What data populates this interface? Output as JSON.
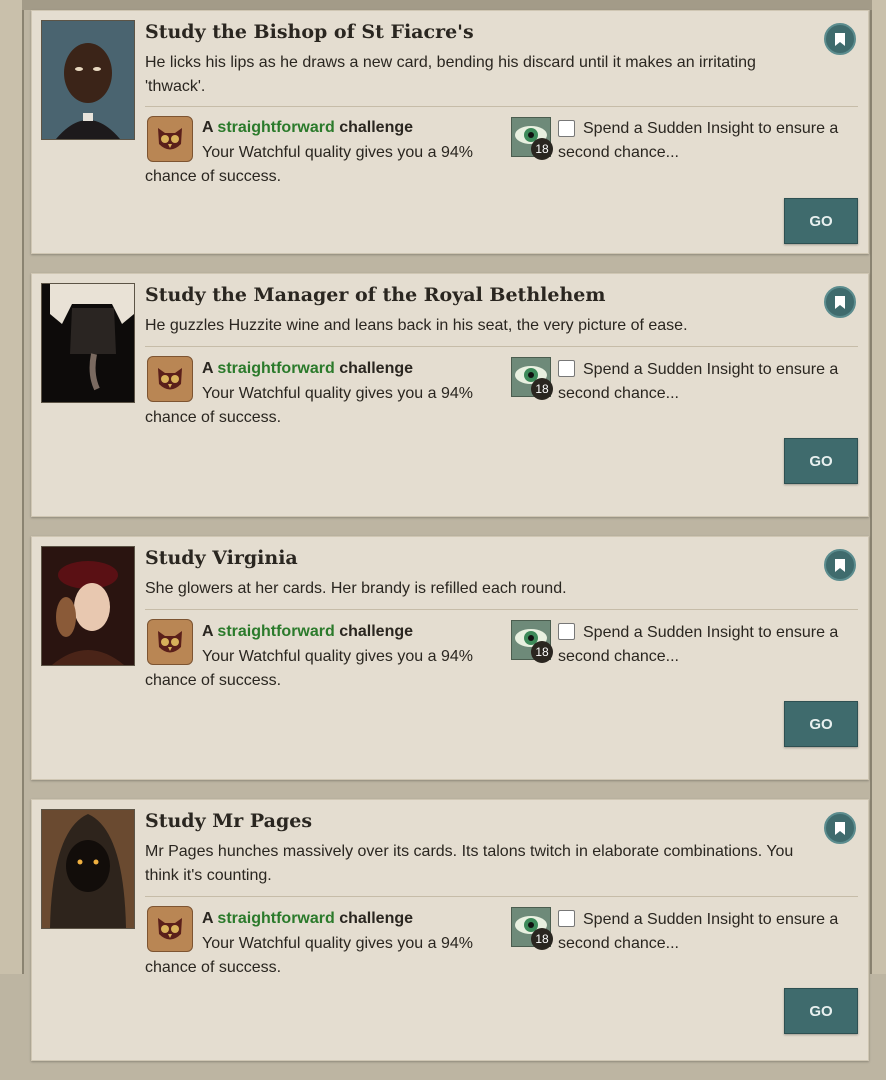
{
  "cards": [
    {
      "title": "Study the Bishop of St Fiacre's",
      "description": "He licks his lips as he draws a new card, bending his discard until it makes an irritating 'thwack'.",
      "challenge_a": "A",
      "challenge_difficulty": "straightforward",
      "challenge_word": "challenge",
      "quality_text": "Your Watchful quality gives you a 94% chance of success.",
      "insight_count": "18",
      "insight_text": "Spend a Sudden Insight to ensure a second chance...",
      "go_label": "GO",
      "portrait_icon": "bishop-portrait"
    },
    {
      "title": "Study the Manager of the Royal Bethlehem",
      "description": "He guzzles Huzzite wine and leans back in his seat, the very picture of ease.",
      "challenge_a": "A",
      "challenge_difficulty": "straightforward",
      "challenge_word": "challenge",
      "quality_text": "Your Watchful quality gives you a 94% chance of success.",
      "insight_count": "18",
      "insight_text": "Spend a Sudden Insight to ensure a second chance...",
      "go_label": "GO",
      "portrait_icon": "manager-portrait"
    },
    {
      "title": "Study Virginia",
      "description": "She glowers at her cards. Her brandy is refilled each round.",
      "challenge_a": "A",
      "challenge_difficulty": "straightforward",
      "challenge_word": "challenge",
      "quality_text": "Your Watchful quality gives you a 94% chance of success.",
      "insight_count": "18",
      "insight_text": "Spend a Sudden Insight to ensure a second chance...",
      "go_label": "GO",
      "portrait_icon": "virginia-portrait"
    },
    {
      "title": "Study Mr Pages",
      "description": "Mr Pages hunches massively over its cards. Its talons twitch in elaborate combinations. You think it's counting.",
      "challenge_a": "A",
      "challenge_difficulty": "straightforward",
      "challenge_word": "challenge",
      "quality_text": "Your Watchful quality gives you a 94% chance of success.",
      "insight_count": "18",
      "insight_text": "Spend a Sudden Insight to ensure a second chance...",
      "go_label": "GO",
      "portrait_icon": "mr-pages-portrait"
    }
  ],
  "colors": {
    "accent": "#3f6b6d",
    "difficulty_green": "#2b7a2b",
    "card_bg": "#e4ddd0"
  }
}
